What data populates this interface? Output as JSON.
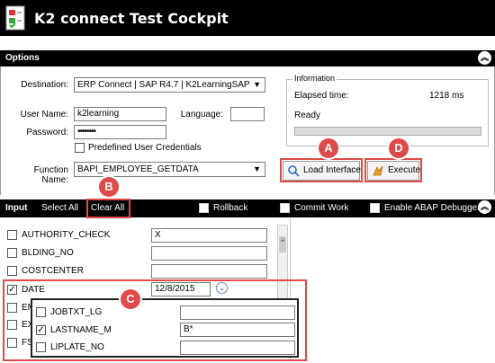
{
  "app": {
    "title": "K2 connect Test Cockpit",
    "icon": "document-check-icon"
  },
  "options": {
    "header": "Options",
    "destination_label": "Destination:",
    "destination_value": "ERP Connect | SAP R4.7 | K2LearningSAP",
    "username_label": "User Name:",
    "username_value": "k2learning",
    "language_label": "Language:",
    "language_value": "",
    "password_label": "Password:",
    "password_value": "••••••••",
    "predefined_label": "Predefined User Credentials",
    "function_label": "Function Name:",
    "function_value": "BAPI_EMPLOYEE_GETDATA"
  },
  "information": {
    "legend": "Information",
    "elapsed_label": "Elapsed time:",
    "elapsed_value": "1218 ms",
    "status": "Ready",
    "progress": 0
  },
  "buttons": {
    "load": "Load Interface",
    "execute": "Execute"
  },
  "callouts": {
    "a": "A",
    "b": "B",
    "c": "C",
    "d": "D"
  },
  "input_bar": {
    "title": "Input",
    "select_all": "Select All",
    "clear_all": "Clear All",
    "rollback": "Rollback",
    "commit": "Commit Work",
    "debugger": "Enable ABAP Debugger"
  },
  "params": [
    {
      "name": "AUTHORITY_CHECK",
      "checked": false,
      "value": "X"
    },
    {
      "name": "BLDING_NO",
      "checked": false,
      "value": ""
    },
    {
      "name": "COSTCENTER",
      "checked": false,
      "value": ""
    },
    {
      "name": "DATE",
      "checked": true,
      "value": "12/8/2015"
    },
    {
      "name": "EM",
      "checked": false,
      "value": ""
    },
    {
      "name": "EX",
      "checked": false,
      "value": ""
    },
    {
      "name": "FS",
      "checked": false,
      "value": ""
    }
  ],
  "popup_params": [
    {
      "name": "JOBTXT_LG",
      "checked": false,
      "value": ""
    },
    {
      "name": "LASTNAME_M",
      "checked": true,
      "value": "B*"
    },
    {
      "name": "LIPLATE_NO",
      "checked": false,
      "value": ""
    }
  ],
  "colors": {
    "accent": "#e04a4a",
    "bar": "#000000"
  }
}
